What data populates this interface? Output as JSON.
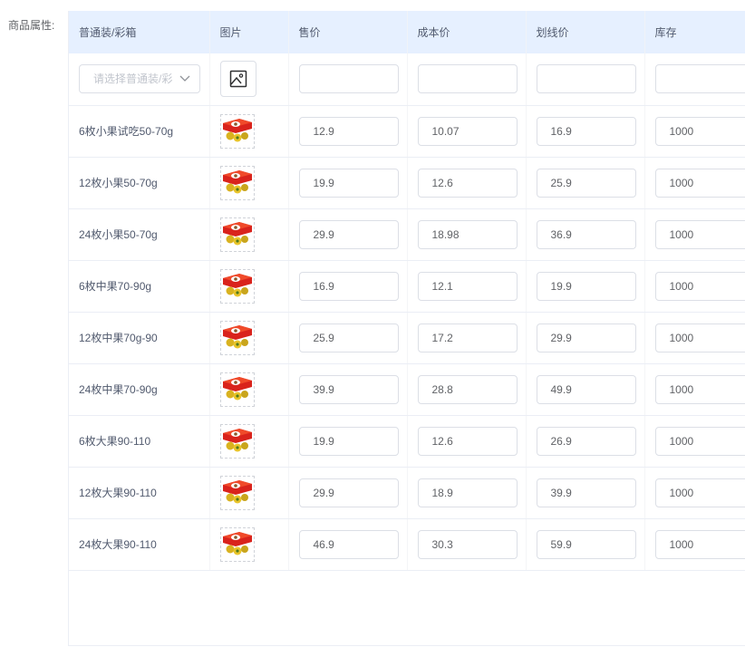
{
  "form": {
    "label": "商品属性:"
  },
  "table": {
    "headers": [
      "普通装/彩箱",
      "图片",
      "售价",
      "成本价",
      "划线价",
      "库存"
    ],
    "new_row": {
      "select_placeholder": "请选择普通装/彩",
      "image_icon": "image-placeholder-icon"
    },
    "rows": [
      {
        "name": "6枚小果试吃50-70g",
        "price": "12.9",
        "cost": "10.07",
        "strike": "16.9",
        "stock": "1000"
      },
      {
        "name": "12枚小果50-70g",
        "price": "19.9",
        "cost": "12.6",
        "strike": "25.9",
        "stock": "1000"
      },
      {
        "name": "24枚小果50-70g",
        "price": "29.9",
        "cost": "18.98",
        "strike": "36.9",
        "stock": "1000"
      },
      {
        "name": "6枚中果70-90g",
        "price": "16.9",
        "cost": "12.1",
        "strike": "19.9",
        "stock": "1000"
      },
      {
        "name": "12枚中果70g-90",
        "price": "25.9",
        "cost": "17.2",
        "strike": "29.9",
        "stock": "1000"
      },
      {
        "name": "24枚中果70-90g",
        "price": "39.9",
        "cost": "28.8",
        "strike": "49.9",
        "stock": "1000"
      },
      {
        "name": "6枚大果90-110",
        "price": "19.9",
        "cost": "12.6",
        "strike": "26.9",
        "stock": "1000"
      },
      {
        "name": "12枚大果90-110",
        "price": "29.9",
        "cost": "18.9",
        "strike": "39.9",
        "stock": "1000"
      },
      {
        "name": "24枚大果90-110",
        "price": "46.9",
        "cost": "30.3",
        "strike": "59.9",
        "stock": "1000"
      }
    ]
  },
  "colors": {
    "header_bg": "#e6f0ff",
    "border": "#dcdfe6",
    "text": "#606266"
  }
}
